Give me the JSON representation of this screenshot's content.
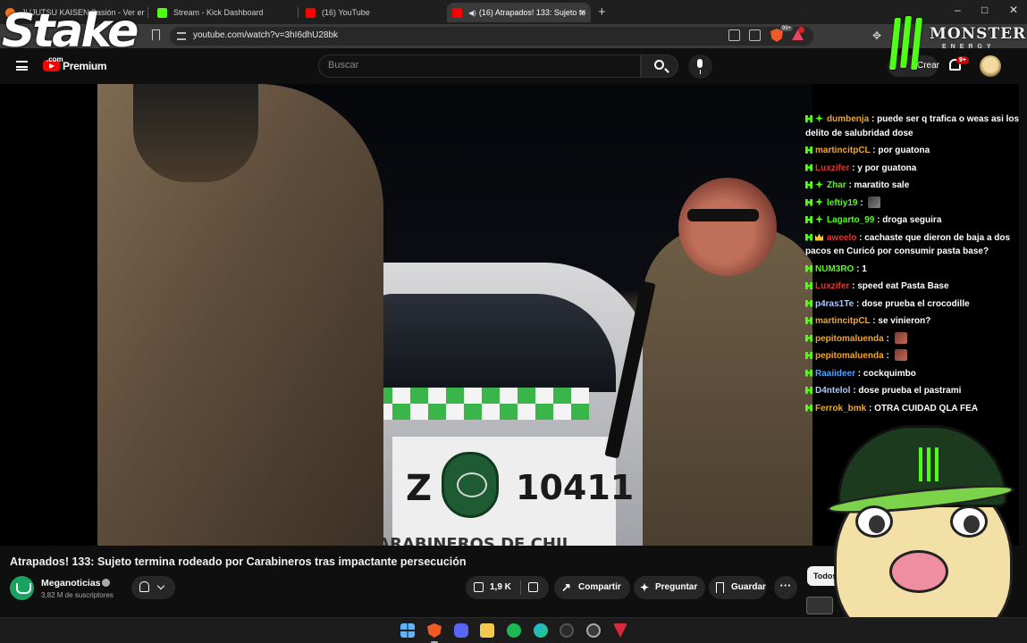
{
  "browser": {
    "tabs": [
      {
        "title": "JUJUTSU KAISEN Pasión - Ver en Cru",
        "favicon_color": "#f47521"
      },
      {
        "title": "Stream - Kick Dashboard",
        "favicon_color": "#53fc18"
      },
      {
        "title": "(16) YouTube",
        "favicon_color": "#ff0000"
      },
      {
        "title": "(16) Atrapados! 133: Sujeto te",
        "favicon_color": "#ff0000"
      }
    ],
    "new_tab_label": "+",
    "window_controls": {
      "minimize": "–",
      "maximize": "□",
      "close": "✕"
    },
    "url": "youtube.com/watch?v=3hI6dhU28bk",
    "shield_badge": "99+",
    "ext_badge": "1"
  },
  "youtube_header": {
    "premium_label": "Premium",
    "search_placeholder": "Buscar",
    "create_label": "Crear",
    "notification_count": "9+"
  },
  "overlays": {
    "stake_logo": "Stake",
    "stake_com": ".com",
    "monster_brand": "MONSTER",
    "monster_sub": "ENERGY"
  },
  "video_scene": {
    "plate_letter": "Z",
    "plate_number": "10411",
    "door_text": "CARABINEROS DE CHIL",
    "emblem_text": "CARABINEROS DE CHILE"
  },
  "chat": [
    {
      "user": "dumbenja",
      "color": "#f5a623",
      "badges": [
        "kick",
        "star"
      ],
      "text": " : puede ser q trafica o weas asi los delito de salubridad dose"
    },
    {
      "user": "martincitpCL",
      "color": "#f5a623",
      "badges": [
        "kick"
      ],
      "text": " : por guatona"
    },
    {
      "user": "Luxzifer",
      "color": "#e8332c",
      "badges": [
        "kick"
      ],
      "text": " : y por guatona"
    },
    {
      "user": "Zhar",
      "color": "#53fc18",
      "badges": [
        "kick",
        "star"
      ],
      "text": " : maratito sale"
    },
    {
      "user": "leftiy19",
      "color": "#53fc18",
      "badges": [
        "kick",
        "star"
      ],
      "text": " : ",
      "emote": "dark"
    },
    {
      "user": "Lagarto_99",
      "color": "#53fc18",
      "badges": [
        "kick",
        "star"
      ],
      "text": " : droga seguira"
    },
    {
      "user": "aweelo",
      "color": "#e8332c",
      "badges": [
        "kick",
        "crown"
      ],
      "text": " : cachaste que dieron de baja a dos pacos en Curicó por consumir pasta base?"
    },
    {
      "user": "NUM3RO",
      "color": "#53fc18",
      "badges": [
        "kick"
      ],
      "text": " : 1"
    },
    {
      "user": "Luxzifer",
      "color": "#e8332c",
      "badges": [
        "kick"
      ],
      "text": " : speed eat Pasta Base"
    },
    {
      "user": "p4ras1Te",
      "color": "#a7c7ff",
      "badges": [
        "kick"
      ],
      "text": " : dose prueba el crocodille"
    },
    {
      "user": "martincitpCL",
      "color": "#f5a623",
      "badges": [
        "kick"
      ],
      "text": " : se vinieron?"
    },
    {
      "user": "pepitomaluenda",
      "color": "#f5a623",
      "badges": [
        "kick"
      ],
      "text": " : ",
      "emote": "red"
    },
    {
      "user": "pepitomaluenda",
      "color": "#f5a623",
      "badges": [
        "kick"
      ],
      "text": " : ",
      "emote": "red"
    },
    {
      "user": "Raaiideer",
      "color": "#4fa3ff",
      "badges": [
        "kick"
      ],
      "text": " : cockquimbo"
    },
    {
      "user": "D4ntelol",
      "color": "#a7c7ff",
      "badges": [
        "kick"
      ],
      "text": " : dose prueba el pastrami"
    },
    {
      "user": "Ferrok_bmk",
      "color": "#f5a623",
      "badges": [
        "kick"
      ],
      "text": " : OTRA CUIDAD QLA FEA"
    }
  ],
  "video_info": {
    "title": "Atrapados! 133: Sujeto termina rodeado por Carabineros tras impactante persecución",
    "channel_name": "Meganoticias",
    "subscribers": "3,82 M de suscriptores",
    "like_count": "1,9 K",
    "share_label": "Compartir",
    "ask_label": "Preguntar",
    "save_label": "Guardar",
    "more_label": "···",
    "chip_label": "Todos"
  },
  "taskbar": {
    "apps": [
      "windows-start",
      "brave",
      "discord",
      "file-explorer",
      "spotify",
      "edge",
      "obs",
      "chrome",
      "vpn"
    ]
  }
}
